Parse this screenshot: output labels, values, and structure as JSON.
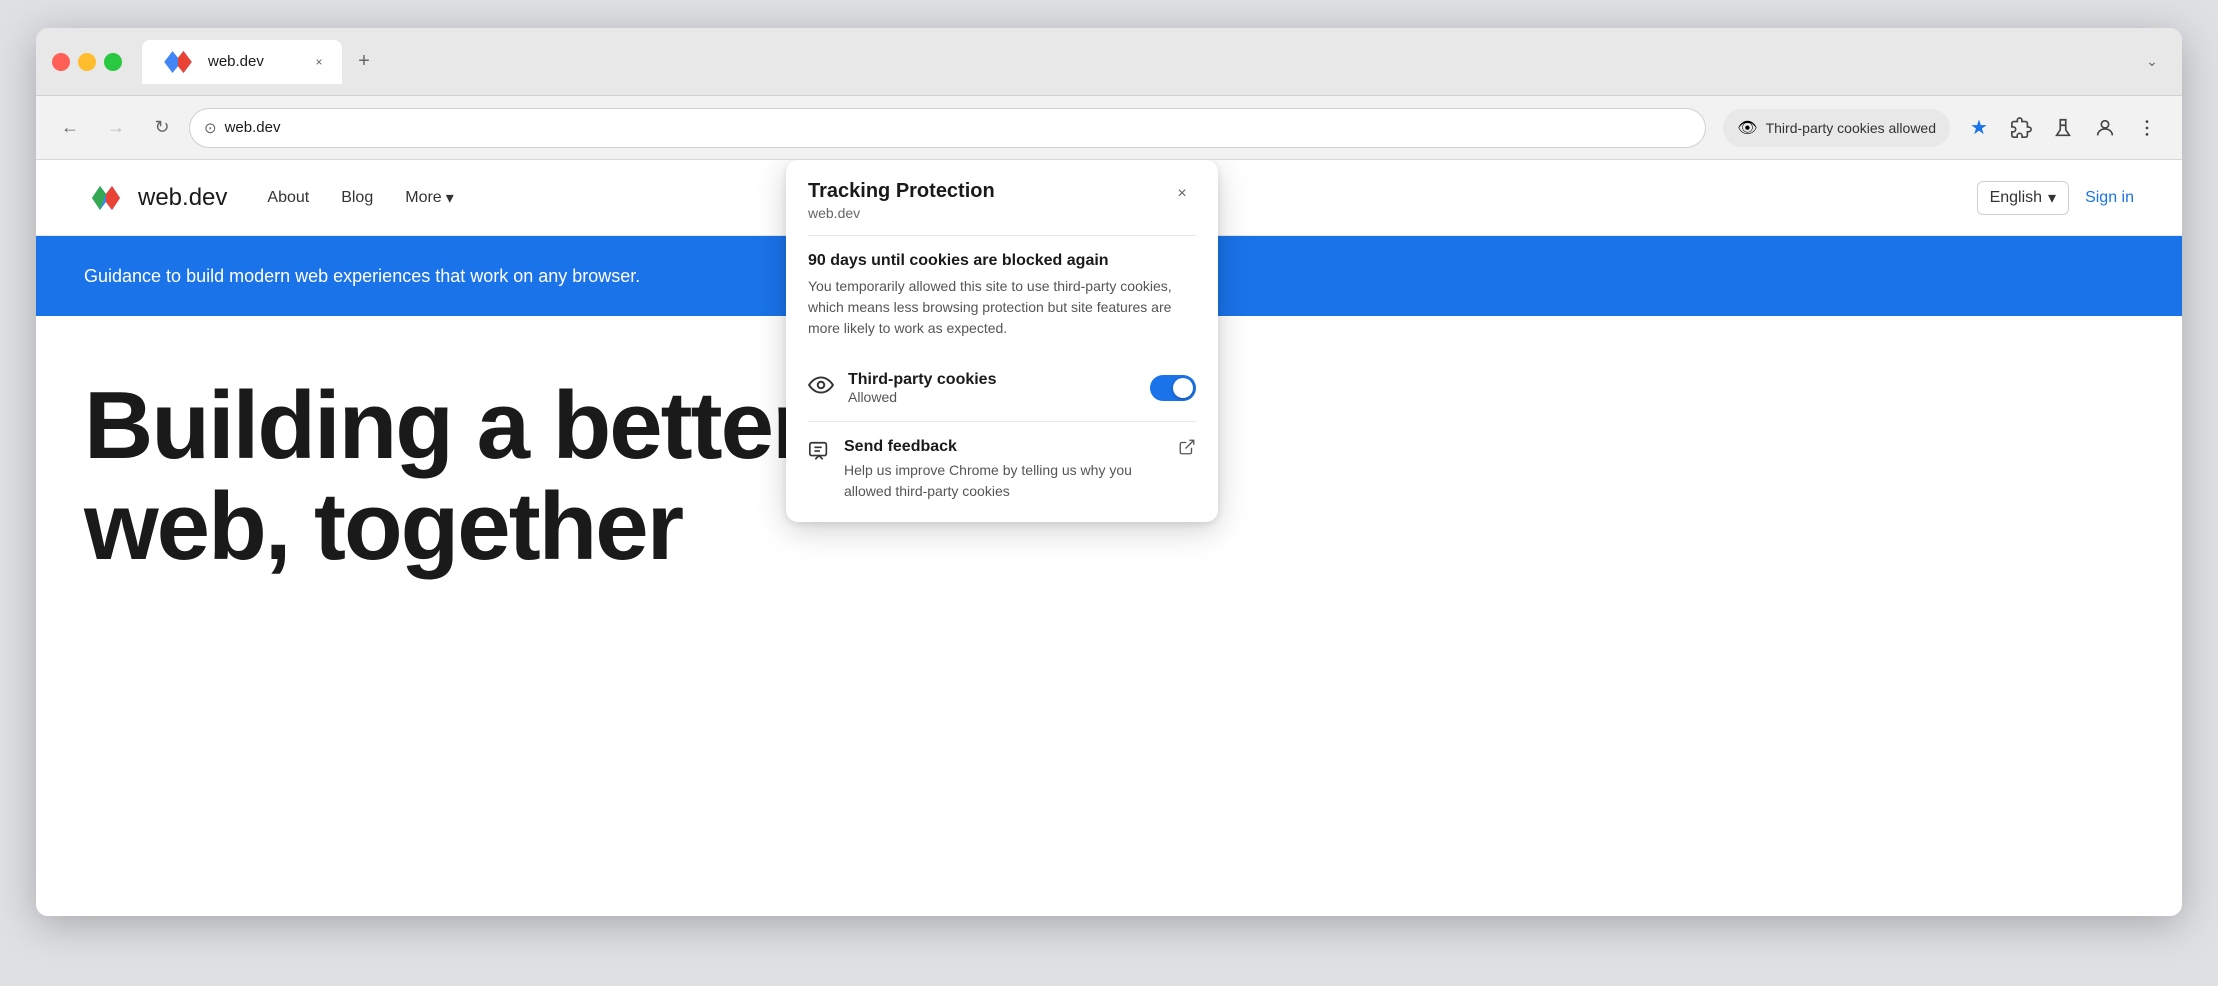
{
  "browser": {
    "tab_title": "web.dev",
    "tab_favicon": ">",
    "tab_close": "×",
    "tab_new": "+",
    "expand_icon": "⌄",
    "nav": {
      "back_icon": "←",
      "forward_icon": "→",
      "refresh_icon": "↻",
      "address_icon": "⊙",
      "address_url": "web.dev",
      "cookie_indicator_icon": "👁",
      "cookie_indicator_text": "Third-party cookies allowed",
      "star_icon": "★",
      "extensions_icon": "🧩",
      "labs_icon": "⚗",
      "profile_icon": "👤",
      "menu_icon": "⋮"
    }
  },
  "website": {
    "logo_text": "web.dev",
    "nav_about": "About",
    "nav_blog": "Blog",
    "nav_more": "More",
    "nav_more_icon": "▾",
    "lang_label": "English",
    "lang_icon": "▾",
    "sign_in": "Sign in",
    "banner_text": "Guidance to build modern web experiences that work on any browser.",
    "hero_line1": "Building a better",
    "hero_line2": "web, together"
  },
  "popup": {
    "title": "Tracking Protection",
    "subtitle": "web.dev",
    "close_icon": "×",
    "days_title": "90 days until cookies are blocked again",
    "days_desc": "You temporarily allowed this site to use third-party cookies, which means less browsing protection but site features are more likely to work as expected.",
    "cookies_icon": "👁",
    "cookies_label": "Third-party cookies",
    "cookies_status": "Allowed",
    "feedback_icon": "💬",
    "feedback_label": "Send feedback",
    "feedback_desc": "Help us improve Chrome by telling us why you allowed third-party cookies",
    "feedback_ext_icon": "⬕"
  }
}
